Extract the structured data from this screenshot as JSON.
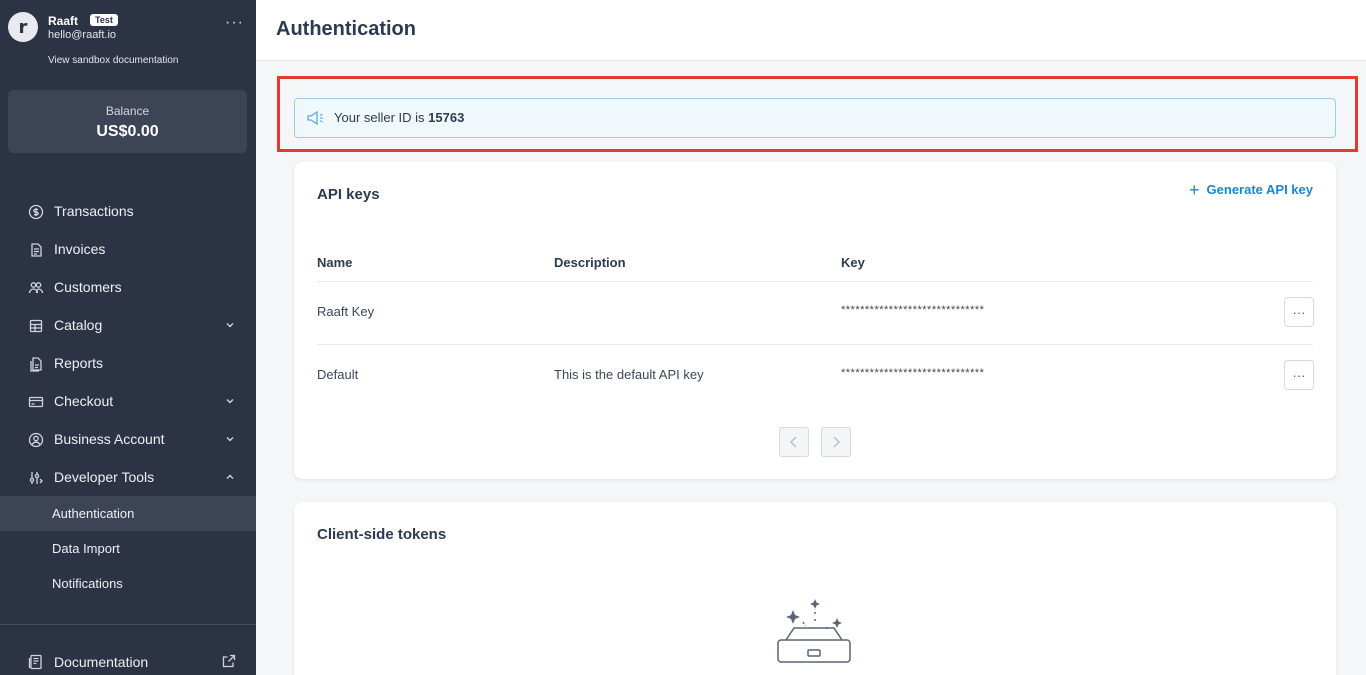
{
  "account": {
    "avatar_letter": "r",
    "name": "Raaft",
    "badge": "Test",
    "email": "hello@raaft.io",
    "sandbox_link": "View sandbox documentation",
    "more_icon": "more-horizontal-icon"
  },
  "balance": {
    "label": "Balance",
    "value": "US$0.00"
  },
  "nav": {
    "items": [
      {
        "label": "Transactions",
        "icon": "dollar-circle-icon"
      },
      {
        "label": "Invoices",
        "icon": "invoice-icon"
      },
      {
        "label": "Customers",
        "icon": "users-icon"
      },
      {
        "label": "Catalog",
        "icon": "catalog-icon",
        "chevron": "down"
      },
      {
        "label": "Reports",
        "icon": "report-icon"
      },
      {
        "label": "Checkout",
        "icon": "credit-card-icon",
        "chevron": "down"
      },
      {
        "label": "Business Account",
        "icon": "user-circle-icon",
        "chevron": "down"
      },
      {
        "label": "Developer Tools",
        "icon": "sliders-icon",
        "chevron": "up"
      }
    ],
    "sub_items": [
      {
        "label": "Authentication",
        "active": true
      },
      {
        "label": "Data Import"
      },
      {
        "label": "Notifications"
      }
    ],
    "documentation": {
      "label": "Documentation",
      "icon": "book-icon",
      "trailing_icon": "external-link-icon"
    }
  },
  "header": {
    "title": "Authentication"
  },
  "seller": {
    "prefix": "Your seller ID is ",
    "id": "15763",
    "icon": "megaphone-icon"
  },
  "api_keys": {
    "title": "API keys",
    "generate_label": "Generate API key",
    "columns": {
      "name": "Name",
      "description": "Description",
      "key": "Key"
    },
    "rows": [
      {
        "name": "Raaft Key",
        "description": "",
        "key": "******************************",
        "menu": "···"
      },
      {
        "name": "Default",
        "description": "This is the default API key",
        "key": "******************************",
        "menu": "···"
      }
    ]
  },
  "tokens": {
    "title": "Client-side tokens",
    "empty_icon": "empty-box-sparkle-icon"
  },
  "colors": {
    "sidebar_bg": "#2c3344",
    "accent": "#1a86d0",
    "highlight": "#e53935"
  }
}
